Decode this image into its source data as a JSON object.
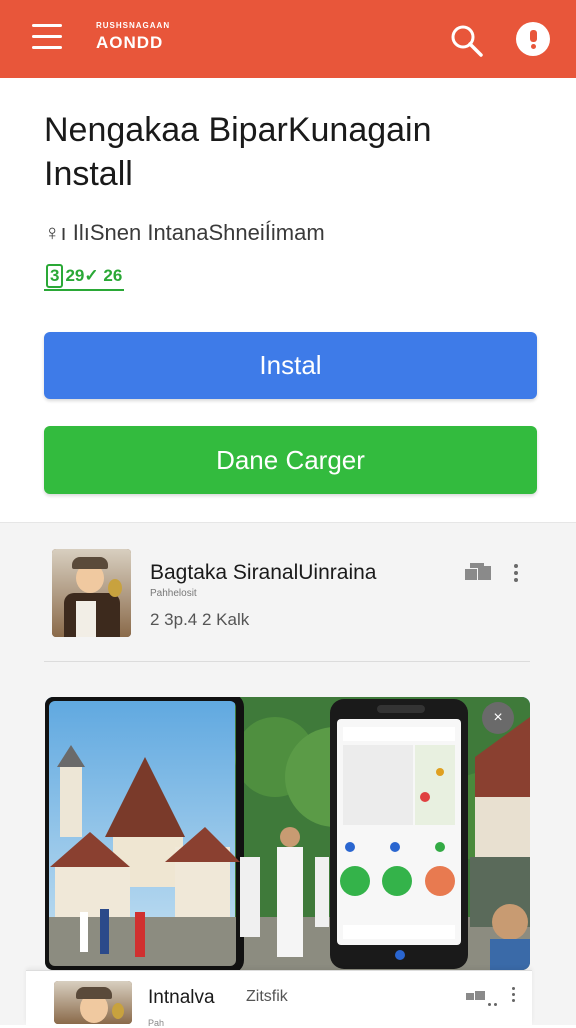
{
  "colors": {
    "topbar": "#e8563a",
    "install_button": "#3e7be8",
    "secondary_button": "#33bb3e",
    "rating_green": "#2aa836"
  },
  "topbar": {
    "brand_small": "RUSHSNAGAAN",
    "brand_big": "AONDD",
    "icons": [
      "menu-icon",
      "search-icon",
      "alert-icon"
    ]
  },
  "app": {
    "title_line1": "Nengakaa BiparKunagain",
    "title_line2": "Install",
    "developer": "♀ı IlıSnen IntanaShneiÍimam",
    "rating_box": "3",
    "rating_value": "29",
    "rating_extra": "✓ 26"
  },
  "buttons": {
    "install": "Instal",
    "secondary": "Dane Carger"
  },
  "listing": {
    "title": "Bagtaka SiranalUinraina",
    "subtitle": "Pahhelosit",
    "meta": "2 3p.4 2 Kalk"
  },
  "bottom_listing": {
    "title": "Intnalva",
    "meta": "Zitsfik",
    "subtitle": "Pah"
  },
  "screenshot": {
    "close_label": "×"
  }
}
